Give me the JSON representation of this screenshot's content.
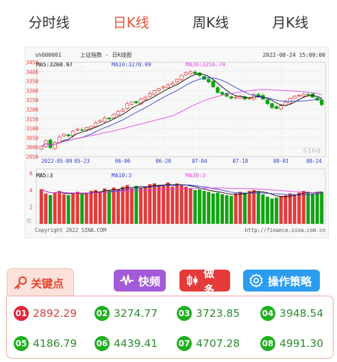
{
  "tabs": [
    {
      "label": "分时线",
      "active": false
    },
    {
      "label": "日K线",
      "active": true
    },
    {
      "label": "周K线",
      "active": false
    },
    {
      "label": "月K线",
      "active": false
    }
  ],
  "chart_header": {
    "code": "sh000001",
    "name": "上证指数 - 日K线图",
    "datetime": "2022-08-24 15:00:00",
    "ma5": "MA5:3260.97",
    "ma10": "MA10:3270.99",
    "ma30": "MA30:3256.79"
  },
  "volume_header": {
    "ma5": "MA5:3",
    "ma10": "MA10:3",
    "ma30": "MA30:3"
  },
  "footer": {
    "copyright": "Copyright 2022 SINA.COM",
    "url": "http://finance.sina.com.cn"
  },
  "watermark": "sina",
  "buttons": {
    "keypoint": "关键点",
    "quick": "快频",
    "doduo": "做多",
    "strategy": "操作策略"
  },
  "colors": {
    "up": "#e23b3b",
    "down": "#11a311",
    "ma5": "#000000",
    "ma10": "#2b3bd6",
    "ma30": "#e340e3",
    "accent": "#e2533a"
  },
  "points": [
    {
      "index": "01",
      "value": "2892.29",
      "color": "red"
    },
    {
      "index": "02",
      "value": "3274.77",
      "color": "green"
    },
    {
      "index": "03",
      "value": "3723.85",
      "color": "green"
    },
    {
      "index": "04",
      "value": "3948.54",
      "color": "green"
    },
    {
      "index": "05",
      "value": "4186.79",
      "color": "green"
    },
    {
      "index": "06",
      "value": "4439.41",
      "color": "green"
    },
    {
      "index": "07",
      "value": "4707.28",
      "color": "green"
    },
    {
      "index": "08",
      "value": "4991.30",
      "color": "green"
    }
  ],
  "chart_data": {
    "type": "candlestick",
    "title": "上证指数 - 日K线图",
    "y_ticks": [
      2950,
      3000,
      3050,
      3100,
      3150,
      3200,
      3250,
      3300,
      3350,
      3400,
      3450
    ],
    "ylim": [
      2950,
      3450
    ],
    "x_tick_labels": [
      "2022-05-09",
      "05-23",
      "06-06",
      "06-20",
      "07-04",
      "07-18",
      "08-01",
      "08-24"
    ],
    "close": [
      3004,
      3035,
      2998,
      3025,
      3055,
      3070,
      3060,
      3085,
      3095,
      3090,
      3105,
      3110,
      3130,
      3140,
      3155,
      3150,
      3175,
      3190,
      3200,
      3230,
      3240,
      3235,
      3255,
      3265,
      3285,
      3300,
      3310,
      3320,
      3330,
      3340,
      3360,
      3380,
      3395,
      3400,
      3390,
      3380,
      3360,
      3345,
      3320,
      3290,
      3280,
      3270,
      3260,
      3265,
      3270,
      3255,
      3260,
      3280,
      3270,
      3255,
      3230,
      3210,
      3205,
      3220,
      3240,
      3260,
      3270,
      3275,
      3280,
      3278,
      3265,
      3250,
      3225
    ],
    "volume": [
      4.1,
      3.6,
      3.4,
      3.7,
      3.9,
      3.5,
      3.4,
      3.6,
      3.8,
      3.5,
      3.7,
      3.9,
      4.0,
      3.8,
      4.2,
      4.0,
      4.3,
      4.1,
      4.4,
      4.6,
      4.2,
      4.5,
      4.3,
      4.4,
      4.7,
      4.8,
      4.6,
      4.5,
      4.9,
      4.4,
      4.8,
      4.6,
      4.4,
      4.2,
      4.0,
      4.1,
      3.9,
      3.8,
      3.6,
      3.7,
      3.5,
      3.4,
      3.3,
      3.6,
      3.8,
      3.7,
      3.9,
      4.0,
      3.8,
      3.5,
      3.2,
      3.0,
      3.1,
      3.3,
      3.4,
      3.6,
      3.5,
      3.7,
      3.9,
      3.8,
      3.6,
      3.7,
      3.8
    ],
    "volume_y_ticks": [
      2,
      4,
      6
    ],
    "volume_unit": "亿",
    "series": [
      {
        "name": "MA5",
        "color": "#000000"
      },
      {
        "name": "MA10",
        "color": "#2b3bd6"
      },
      {
        "name": "MA30",
        "color": "#e340e3"
      }
    ]
  }
}
